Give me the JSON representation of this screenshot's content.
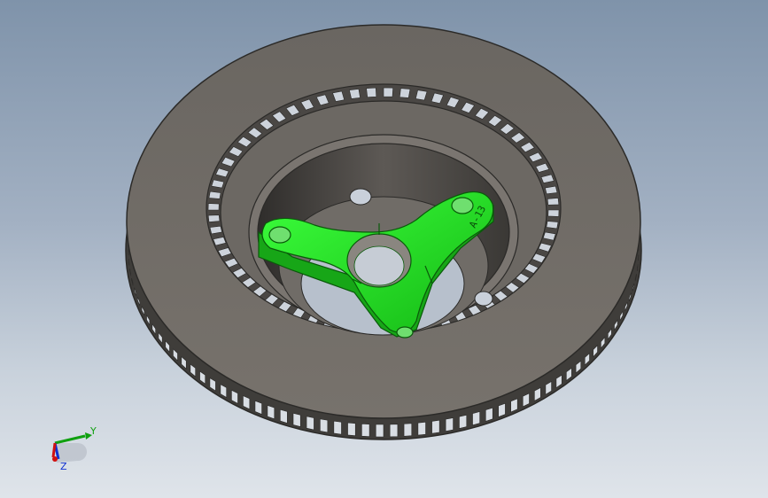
{
  "viewport": {
    "background_top": "#7f93aa",
    "background_bottom": "#dfe4ea"
  },
  "model": {
    "rotor_color": "#6f6b66",
    "rotor_edge_color": "#2b2a28",
    "hub_color": "#20e020",
    "hub_edge_color": "#0a5a0a",
    "hub_engraving": "A-13"
  },
  "triad": {
    "x_color": "#d01010",
    "y_color": "#10a010",
    "z_color": "#1030d0",
    "y_label": "Y",
    "z_label": "Z"
  }
}
